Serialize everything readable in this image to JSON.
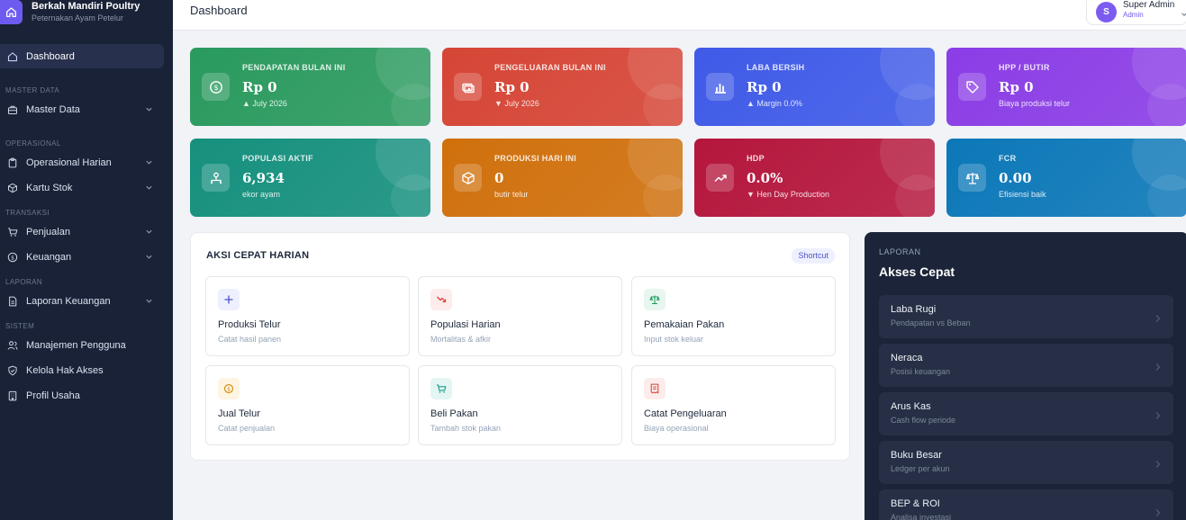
{
  "brand": {
    "name": "Berkah Mandiri Poultry",
    "subtitle": "Peternakan Ayam Petelur"
  },
  "topbar": {
    "title": "Dashboard",
    "user_name": "Super Admin",
    "user_role": "Admin",
    "avatar_initial": "S"
  },
  "sidebar": {
    "dashboard": "Dashboard",
    "sections": {
      "master": "MASTER DATA",
      "operasional": "OPERASIONAL",
      "transaksi": "TRANSAKSI",
      "laporan": "LAPORAN",
      "sistem": "SISTEM"
    },
    "items": {
      "master_data": "Master Data",
      "operasional_harian": "Operasional Harian",
      "kartu_stok": "Kartu Stok",
      "penjualan": "Penjualan",
      "keuangan": "Keuangan",
      "laporan_keuangan": "Laporan Keuangan",
      "manajemen_pengguna": "Manajemen Pengguna",
      "kelola_hak_akses": "Kelola Hak Akses",
      "profil_usaha": "Profil Usaha"
    }
  },
  "stats": [
    {
      "title": "PENDAPATAN BULAN INI",
      "value": "Rp 0",
      "sub": "▲ July 2026",
      "color": "#2a9a5e",
      "icon": "dollar-icon"
    },
    {
      "title": "PENGELUARAN BULAN INI",
      "value": "Rp 0",
      "sub": "▼ July 2026",
      "color": "#d64535",
      "icon": "cash-icon"
    },
    {
      "title": "LABA BERSIH",
      "value": "Rp 0",
      "sub": "▲ Margin 0.0%",
      "color": "#3f5ae8",
      "icon": "bar-chart-icon"
    },
    {
      "title": "HPP / BUTIR",
      "value": "Rp 0",
      "sub": "Biaya produksi telur",
      "color": "#8b3de6",
      "icon": "tag-icon"
    },
    {
      "title": "POPULASI AKTIF",
      "value": "6,934",
      "sub": "ekor ayam",
      "color": "#16907e",
      "icon": "users-icon"
    },
    {
      "title": "PRODUKSI HARI INI",
      "value": "0",
      "sub": "butir telur",
      "color": "#d0700c",
      "icon": "box-icon"
    },
    {
      "title": "HDP",
      "value": "0.0%",
      "sub": "▼ Hen Day Production",
      "color": "#b5163c",
      "icon": "trend-up-icon"
    },
    {
      "title": "FCR",
      "value": "0.00",
      "sub": "Efisiensi baik",
      "color": "#0c78b8",
      "icon": "scale-icon"
    }
  ],
  "quick_actions": {
    "title": "AKSI CEPAT HARIAN",
    "badge": "Shortcut",
    "items": [
      {
        "title": "Produksi Telur",
        "sub": "Catat hasil panen",
        "icon": "plus-icon",
        "bg": "#eef0fd",
        "fg": "#4b52c8"
      },
      {
        "title": "Populasi Harian",
        "sub": "Mortalitas & afkir",
        "icon": "trend-down-icon",
        "bg": "#fdecec",
        "fg": "#e0443a"
      },
      {
        "title": "Pemakaian Pakan",
        "sub": "Input stok keluar",
        "icon": "scale-icon",
        "bg": "#e7f6ee",
        "fg": "#1f9a5c"
      },
      {
        "title": "Jual Telur",
        "sub": "Catat penjualan",
        "icon": "coin-icon",
        "bg": "#fdf4e2",
        "fg": "#d48a0e"
      },
      {
        "title": "Beli Pakan",
        "sub": "Tambah stok pakan",
        "icon": "cart-icon",
        "bg": "#e4f6f3",
        "fg": "#1a9c88"
      },
      {
        "title": "Catat Pengeluaran",
        "sub": "Biaya operasional",
        "icon": "receipt-icon",
        "bg": "#fdecec",
        "fg": "#d64535"
      }
    ]
  },
  "laporan": {
    "label": "LAPORAN",
    "title": "Akses Cepat",
    "items": [
      {
        "title": "Laba Rugi",
        "sub": "Pendapatan vs Beban"
      },
      {
        "title": "Neraca",
        "sub": "Posisi keuangan"
      },
      {
        "title": "Arus Kas",
        "sub": "Cash flow periode"
      },
      {
        "title": "Buku Besar",
        "sub": "Ledger per akun"
      },
      {
        "title": "BEP & ROI",
        "sub": "Analisa investasi"
      }
    ]
  }
}
